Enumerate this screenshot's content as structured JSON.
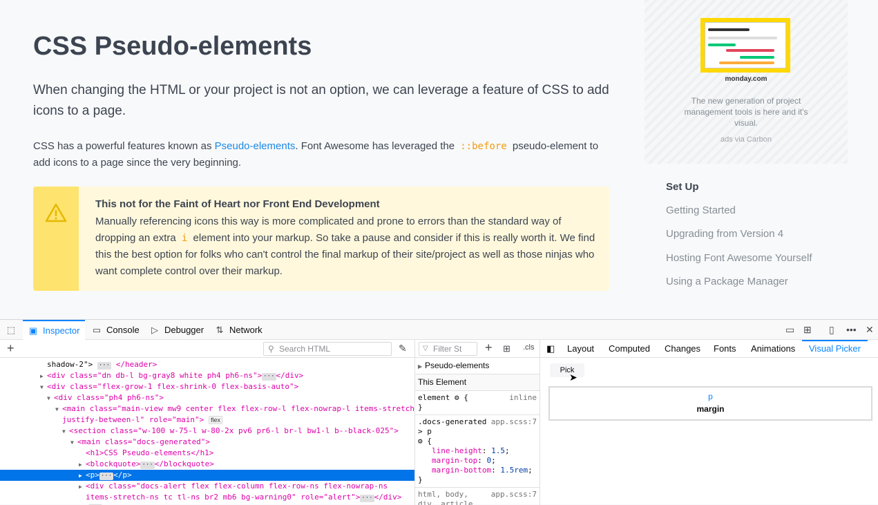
{
  "page": {
    "title": "CSS Pseudo-elements",
    "lead": "When changing the HTML or your project is not an option, we can leverage a feature of CSS to add icons to a page.",
    "para_start": "CSS has a powerful features known as ",
    "para_link": "Pseudo-elements",
    "para_mid": ". Font Awesome has leveraged the ",
    "para_code": "::before",
    "para_end": " pseudo-element to add icons to a page since the very beginning.",
    "alert": {
      "title": "This not for the Faint of Heart nor Front End Development",
      "body_start": "Manually referencing icons this way is more complicated and prone to errors than the standard way of dropping an extra ",
      "body_code": "i",
      "body_end": " element into your markup. So take a pause and consider if this is really worth it. We find this the best option for folks who can't control the final markup of their site/project as well as those ninjas who want complete control over their markup."
    }
  },
  "ad": {
    "logo": "monday.com",
    "text": "The new generation of project management tools is here and it's visual.",
    "via": "ads via Carbon"
  },
  "sidebar": {
    "heading": "Set Up",
    "items": [
      "Getting Started",
      "Upgrading from Version 4",
      "Hosting Font Awesome Yourself",
      "Using a Package Manager"
    ]
  },
  "devtools": {
    "tabs": [
      "Inspector",
      "Console",
      "Debugger",
      "Network"
    ],
    "search_placeholder": "Search HTML",
    "filter_placeholder": "Filter St",
    "cls": ".cls",
    "pseudo_elements": "Pseudo-elements",
    "this_element": "This Element",
    "rules": [
      {
        "selector": "element ⚙ {",
        "source": "inline",
        "close": "}"
      },
      {
        "selector": ".docs-generated > p",
        "source": "app.scss:7"
      },
      {
        "selector": "html, body, div, article,",
        "source": "app.scss:7"
      }
    ],
    "props": [
      {
        "name": "line-height",
        "value": "1.5"
      },
      {
        "name": "margin-top",
        "value": "0"
      },
      {
        "name": "margin-bottom",
        "value": "1.5rem"
      }
    ],
    "right_tabs": [
      "Layout",
      "Computed",
      "Changes",
      "Fonts",
      "Animations",
      "Visual Picker"
    ],
    "pick": "Pick",
    "box_el": "p",
    "box_label": "margin",
    "tree": [
      "shadow-2\">",
      "<div class=\"dn db-l bg-gray8 white ph4 ph6-ns\">",
      "<div class=\"flex-grow-1 flex-shrink-0 flex-basis-auto\">",
      "<div class=\"ph4 ph6-ns\">",
      "<main class=\"main-view mw9 center flex flex-row-l flex-nowrap-l items-stretch",
      "justify-between-l\" role=\"main\">",
      "<section class=\"w-100 w-75-l w-80-2x pv6 pr6-l br-l bw1-l b--black-025\">",
      "<main class=\"docs-generated\">",
      "<h1>CSS Pseudo-elements</h1>",
      "<blockquote>",
      "<p>",
      "<div class=\"docs-alert flex flex-column flex-row-ns flex-nowrap-ns",
      "items-stretch-ns tc tl-ns br2 mb6 bg-warning0\" role=\"alert\">"
    ]
  }
}
